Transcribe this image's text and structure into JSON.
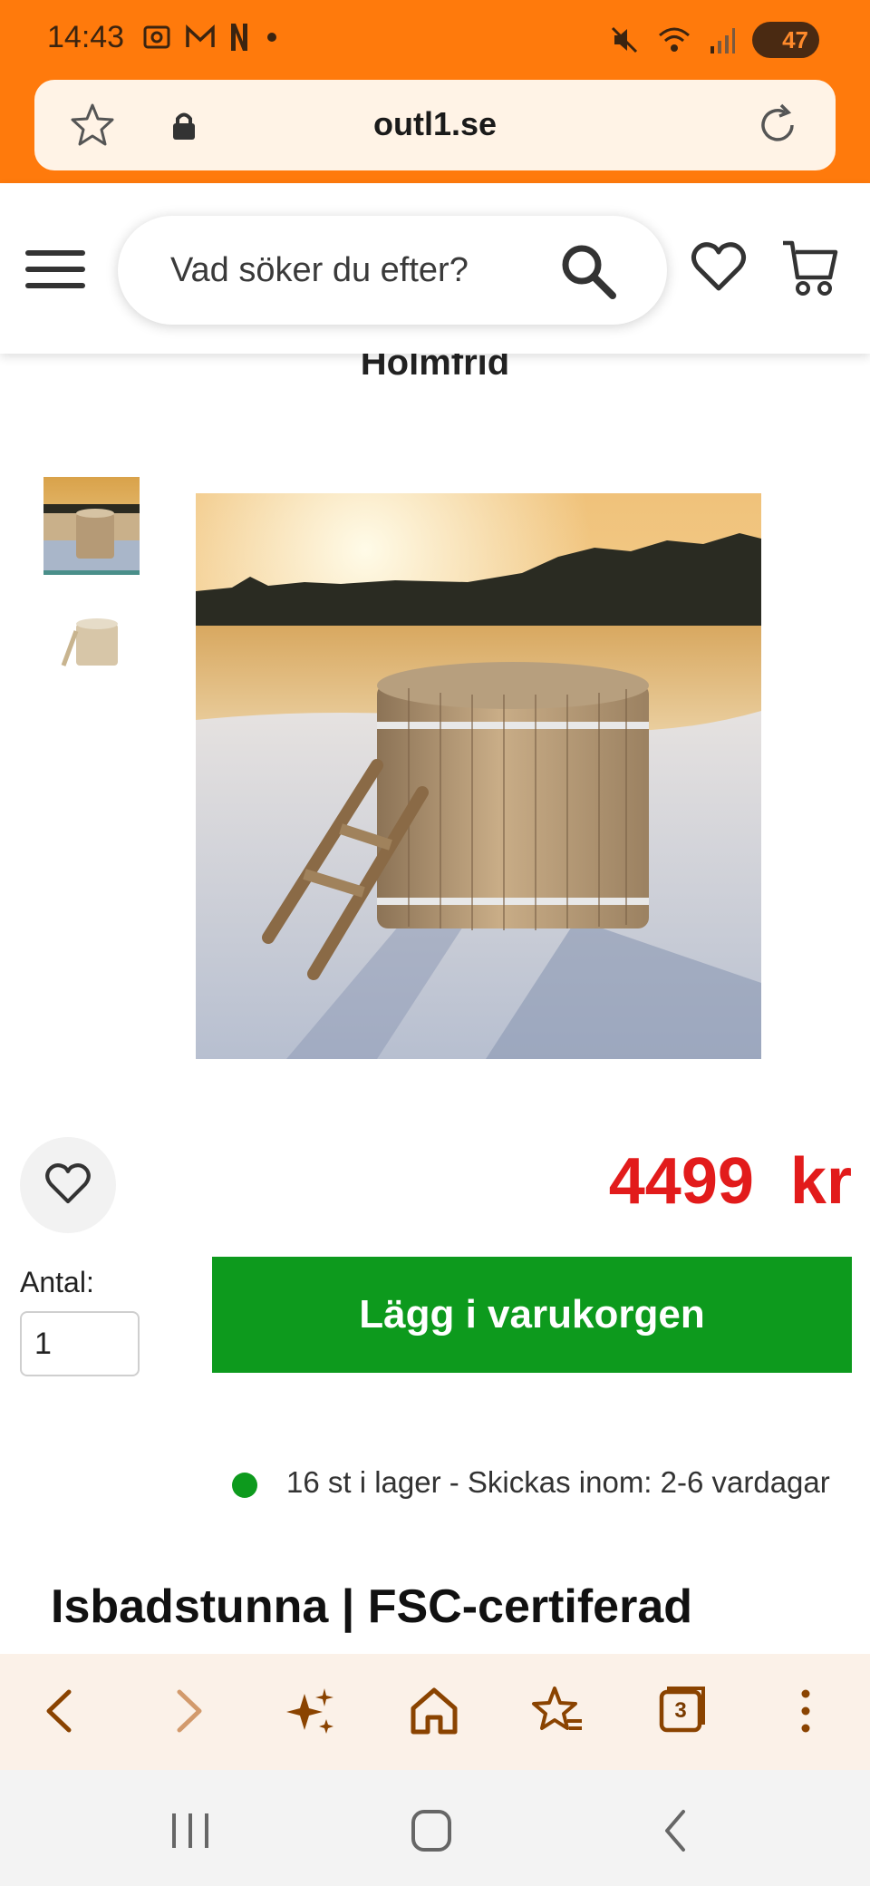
{
  "status_bar": {
    "time": "14:43",
    "battery": "47"
  },
  "browser": {
    "url": "outl1.se"
  },
  "header": {
    "search_placeholder": "Vad söker du efter?"
  },
  "product": {
    "title_partial": "Holmfrid",
    "price": "4499  kr",
    "qty_label": "Antal:",
    "qty_value": "1",
    "add_to_cart": "Lägg i varukorgen",
    "stock": "16 st i lager - Skickas inom: 2-6 vardagar",
    "heading": "Isbadstunna | FSC-certiferad"
  },
  "toolbar": {
    "tabs_count": "3"
  },
  "colors": {
    "browser_accent": "#ff7a0c",
    "price": "#e21b1b",
    "cta": "#0d9a1d",
    "toolbar_icon": "#8a4300"
  },
  "icons": [
    "star-icon",
    "lock-icon",
    "reload-icon",
    "menu-icon",
    "search-icon",
    "heart-icon",
    "cart-icon",
    "back-icon",
    "forward-icon",
    "sparkle-icon",
    "home-icon",
    "bookmarks-icon",
    "tabs-icon",
    "more-icon",
    "recents-icon",
    "home-nav-icon",
    "back-nav-icon"
  ]
}
